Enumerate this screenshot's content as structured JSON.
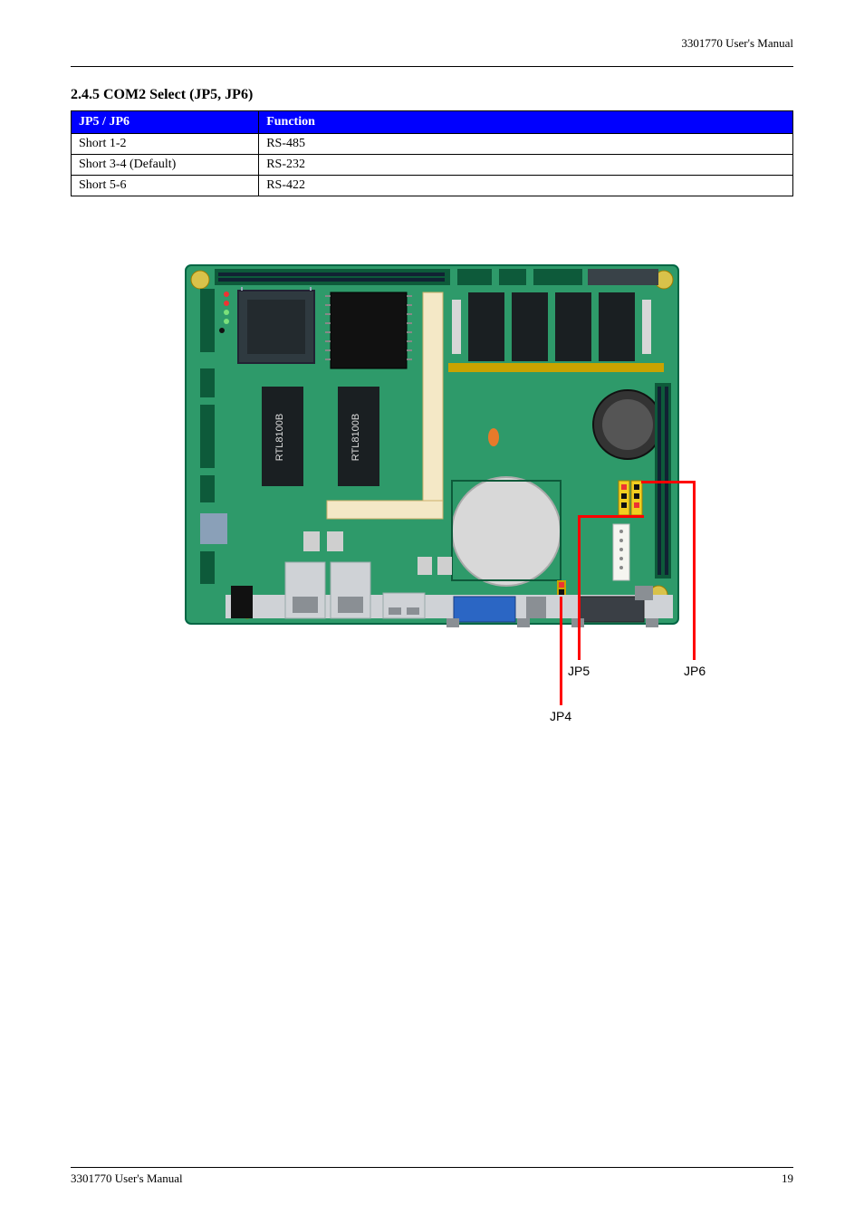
{
  "header": {
    "right": "3301770 User's Manual"
  },
  "jumper_table": {
    "title": "2.4.5 COM2 Select (JP5, JP6)",
    "cols": [
      "JP5 / JP6",
      "Function"
    ],
    "rows": [
      {
        "col1": "Short 1-2",
        "col2": "RS-485"
      },
      {
        "col1": "Short 3-4 (Default)",
        "col2": "RS-232"
      },
      {
        "col1": "Short 5-6",
        "col2": "RS-422"
      }
    ]
  },
  "callouts": {
    "jp4": "JP4",
    "jp5": "JP5",
    "jp6": "JP6"
  },
  "chips": {
    "rtl1": "RTL8100B",
    "rtl2": "RTL8100B"
  },
  "footer": {
    "left": "3301770 User's Manual",
    "right": "19"
  }
}
